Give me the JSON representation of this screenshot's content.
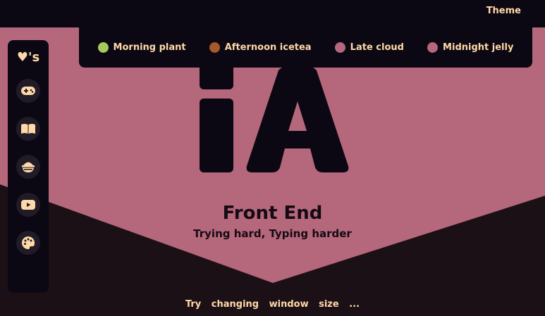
{
  "header": {
    "theme_label": "Theme"
  },
  "theme_menu": {
    "options": [
      {
        "label": "Morning plant",
        "color": "#a5c95b"
      },
      {
        "label": "Afternoon icetea",
        "color": "#a45a2a"
      },
      {
        "label": "Late cloud",
        "color": "#b5677c"
      },
      {
        "label": "Midnight jelly",
        "color": "#b5677c"
      }
    ]
  },
  "sidebar": {
    "logo": "♥'s",
    "items": [
      {
        "icon": "gamepad-icon"
      },
      {
        "icon": "book-icon"
      },
      {
        "icon": "bowl-icon"
      },
      {
        "icon": "youtube-icon"
      },
      {
        "icon": "palette-icon"
      }
    ]
  },
  "hero": {
    "title": "Front End",
    "subtitle": "Trying hard, Typing harder"
  },
  "footer": {
    "text": "Try changing window size ..."
  },
  "colors": {
    "background": "#b5677c",
    "dark": "#0b0813",
    "accent": "#ffd8a8"
  }
}
